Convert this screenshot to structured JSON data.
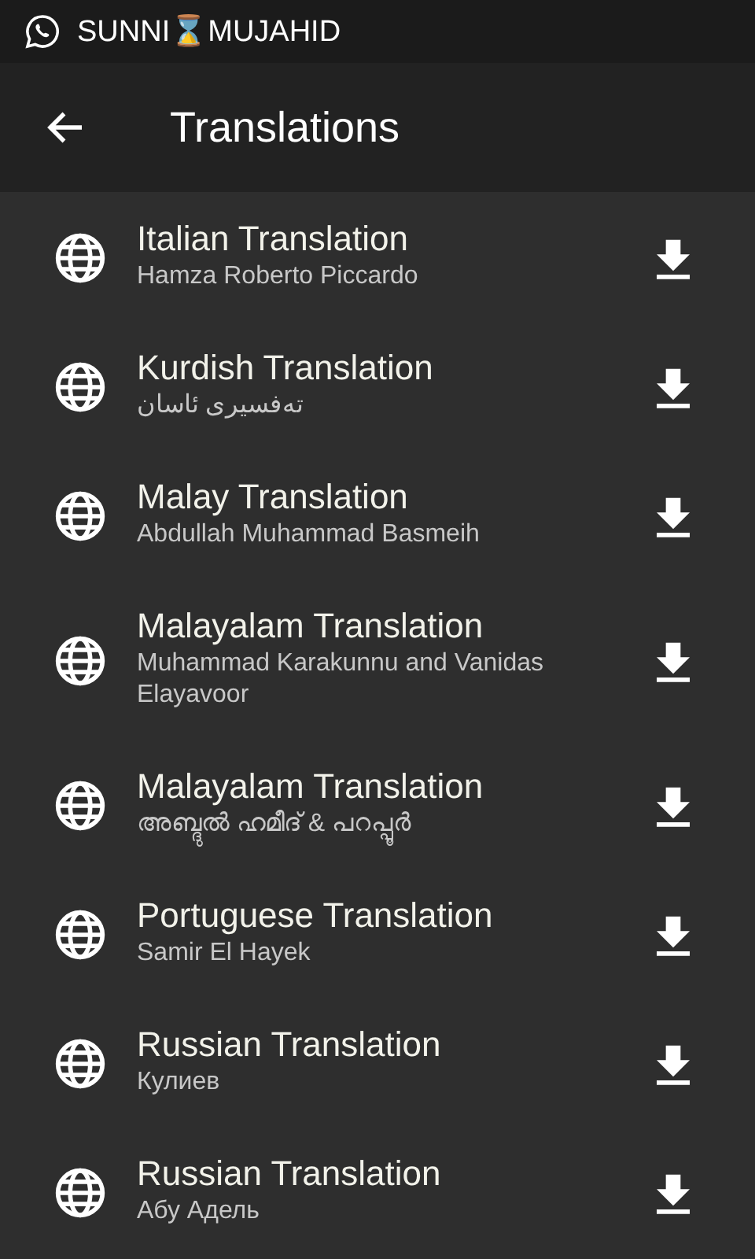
{
  "status_bar": {
    "notification": "SUNNI⌛MUJAHID"
  },
  "toolbar": {
    "title": "Translations"
  },
  "translations": [
    {
      "title": "Italian Translation",
      "author": "Hamza Roberto Piccardo"
    },
    {
      "title": "Kurdish Translation",
      "author": "تەفسیری ئاسان"
    },
    {
      "title": "Malay Translation",
      "author": "Abdullah Muhammad Basmeih"
    },
    {
      "title": "Malayalam Translation",
      "author": "Muhammad Karakunnu and Vanidas Elayavoor"
    },
    {
      "title": "Malayalam Translation",
      "author": "അബ്ദുൽ ഹമീദ് & പറപ്പൂർ"
    },
    {
      "title": "Portuguese Translation",
      "author": "Samir El Hayek"
    },
    {
      "title": "Russian Translation",
      "author": "Кулиев"
    },
    {
      "title": "Russian Translation",
      "author": "Абу Адель"
    }
  ]
}
